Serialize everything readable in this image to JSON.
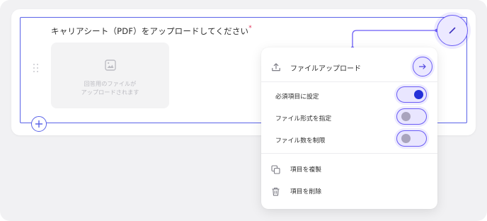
{
  "question": {
    "title": "キャリアシート（PDF）をアップロードしてください",
    "required_mark": "*",
    "upload_hint_line1": "回答用のファイルが",
    "upload_hint_line2": "アップロードされます"
  },
  "menu": {
    "header_label": "ファイルアップロード",
    "toggles": [
      {
        "label": "必須項目に設定",
        "on": true
      },
      {
        "label": "ファイル形式を指定",
        "on": false
      },
      {
        "label": "ファイル数を制限",
        "on": false
      }
    ],
    "actions": [
      {
        "label": "項目を複製",
        "icon": "duplicate-icon"
      },
      {
        "label": "項目を削除",
        "icon": "trash-icon"
      }
    ]
  },
  "colors": {
    "accent": "#6a5cf6",
    "selection": "#5a63e8",
    "toggle_on_knob": "#2430d8",
    "required": "#e0335a"
  }
}
